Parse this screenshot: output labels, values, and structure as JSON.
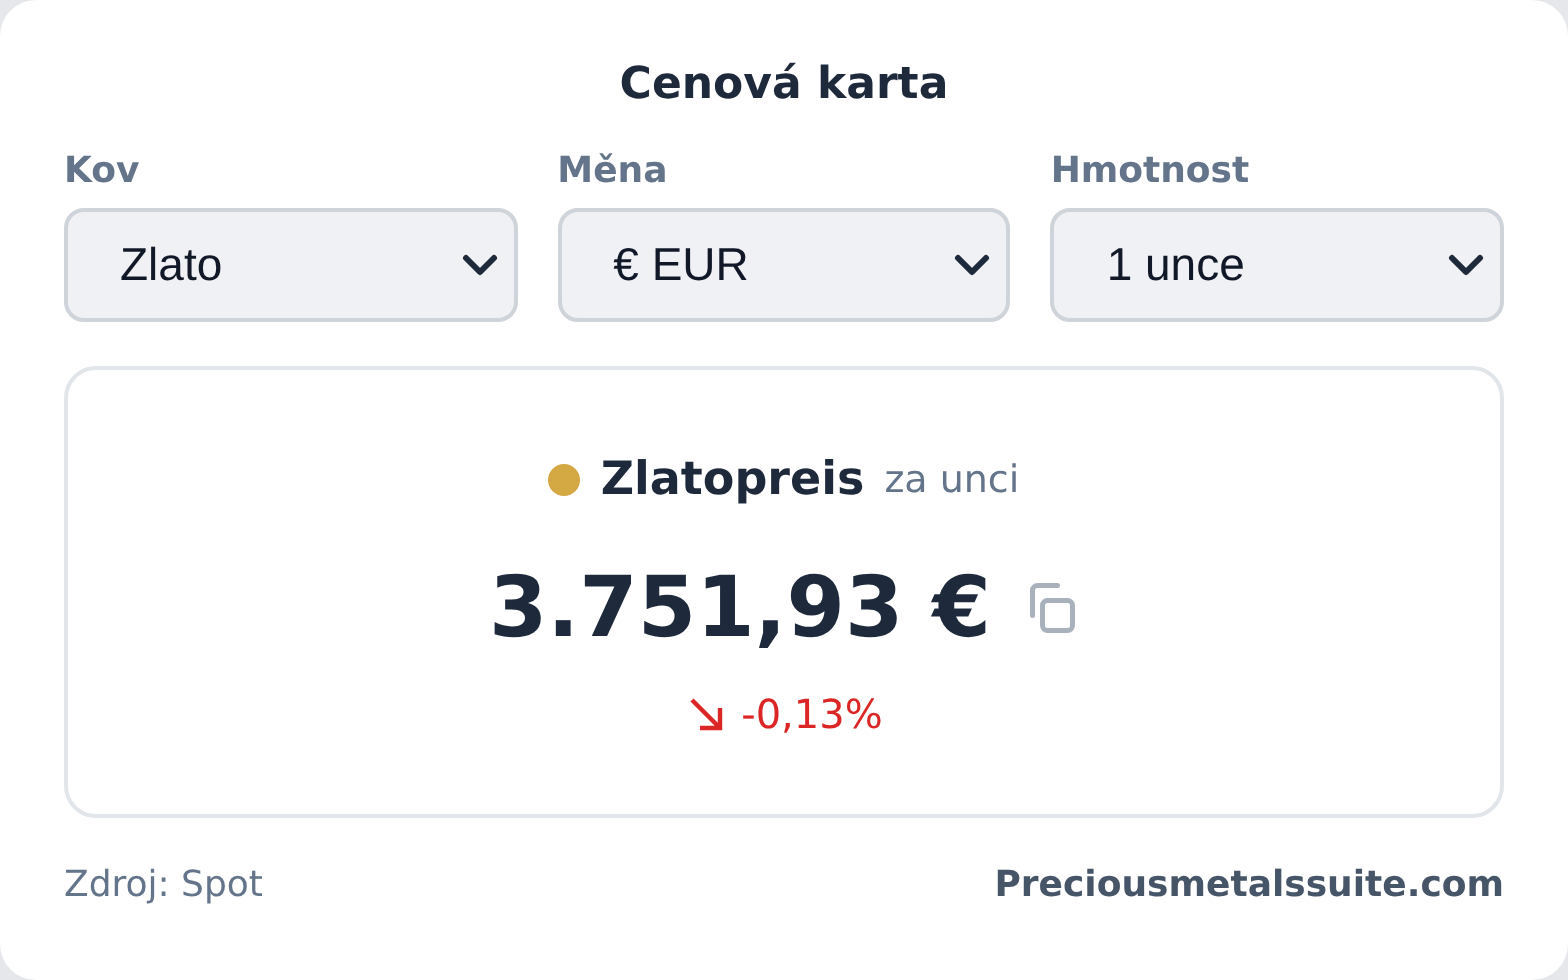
{
  "title": "Cenová karta",
  "selects": [
    {
      "label": "Kov",
      "value": "Zlato"
    },
    {
      "label": "Měna",
      "value": "€ EUR"
    },
    {
      "label": "Hmotnost",
      "value": "1 unce"
    }
  ],
  "price": {
    "metal": "Zlatopreis",
    "color": "#d4a843",
    "unit": "za unci",
    "value": "3.751,93 €",
    "change": "-0,13%",
    "falling": true
  },
  "footer": {
    "source": "Zdroj: Spot",
    "site": "Preciousmetalssuite.com"
  }
}
